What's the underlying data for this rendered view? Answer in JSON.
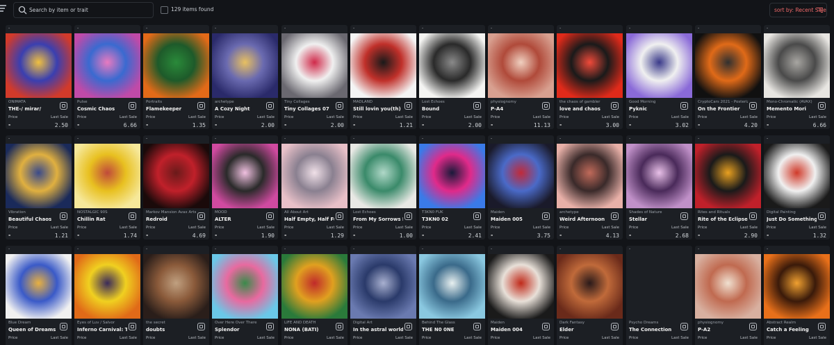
{
  "toolbar": {
    "search_placeholder": "Search by item or trait",
    "items_found": "129 items found",
    "sort_label": "sort by: Recent Sale",
    "accent": "#f06a6a"
  },
  "card_labels": {
    "placeholder": "-",
    "price_label": "Price",
    "last_sale_label": "Last Sale",
    "price_value": "-"
  },
  "items": [
    {
      "collection": "ONIMATA",
      "name": "THE-/ mirar/",
      "last_sale": "2.50",
      "colors": [
        "#d23a2a",
        "#3a3fb0",
        "#f0c040"
      ]
    },
    {
      "collection": "Pulse",
      "name": "Cosmic Chaos",
      "last_sale": "6.66",
      "colors": [
        "#c04aa8",
        "#3a6ad0",
        "#e87ac0"
      ]
    },
    {
      "collection": "Portraits",
      "name": "Flamekeeper",
      "last_sale": "1.35",
      "colors": [
        "#e36a18",
        "#1e5a2a",
        "#2a8a3a"
      ]
    },
    {
      "collection": "archetype",
      "name": "A Cozy Night",
      "last_sale": "2.00",
      "colors": [
        "#2a2a6a",
        "#6a6ab0",
        "#e8c060"
      ]
    },
    {
      "collection": "Tiny Collages",
      "name": "Tiny Collages 07",
      "last_sale": "2.00",
      "colors": [
        "#6a6870",
        "#f0f0f0",
        "#d02a4a"
      ]
    },
    {
      "collection": "MADLAND",
      "name": "Still lovin you(th)",
      "last_sale": "1.21",
      "colors": [
        "#f4f4f4",
        "#c0302a",
        "#1a1a1a"
      ]
    },
    {
      "collection": "Lost Echoes",
      "name": "Bound",
      "last_sale": "2.00",
      "colors": [
        "#f4f4f2",
        "#2a2a2a",
        "#8a8a8a"
      ]
    },
    {
      "collection": "physiognomy",
      "name": "P-A4",
      "last_sale": "11.13",
      "colors": [
        "#d8a090",
        "#b04a3a",
        "#f0d0c0"
      ]
    },
    {
      "collection": "the chaos of gambler",
      "name": "love and chaos",
      "last_sale": "3.00",
      "colors": [
        "#e02a1a",
        "#1a1a1a",
        "#f04a3a"
      ]
    },
    {
      "collection": "Good Morning",
      "name": "Pyknic",
      "last_sale": "3.02",
      "colors": [
        "#8a6ad8",
        "#f0f0f0",
        "#3a3a8a"
      ]
    },
    {
      "collection": "CryptoCars 2021 - Posterized",
      "name": "On the Frontier",
      "last_sale": "4.20",
      "colors": [
        "#101010",
        "#e06a18",
        "#303030"
      ]
    },
    {
      "collection": "Mono-Chromatic (AVAX)",
      "name": "Memento Mori",
      "last_sale": "6.66",
      "colors": [
        "#e8e6e2",
        "#4a4a4a",
        "#a8a6a2"
      ]
    },
    {
      "collection": "Vibration",
      "name": "Beautiful Chaos",
      "last_sale": "1.21",
      "colors": [
        "#1a2a5a",
        "#e0b040",
        "#3a4a8a"
      ]
    },
    {
      "collection": "NOSTALGIC 90S",
      "name": "Chillin Rat",
      "last_sale": "1.74",
      "colors": [
        "#f6e89a",
        "#e8c020",
        "#c04a3a"
      ]
    },
    {
      "collection": "Markov Mansion Avax Arts",
      "name": "Redroid",
      "last_sale": "4.69",
      "colors": [
        "#1a0a0a",
        "#c0202a",
        "#6a1a1a"
      ]
    },
    {
      "collection": "MOOD",
      "name": "ALTER",
      "last_sale": "1.90",
      "colors": [
        "#d04aa0",
        "#2a2a2a",
        "#f0c0e0"
      ]
    },
    {
      "collection": "All About Art",
      "name": "Half Empty, Half Full !",
      "last_sale": "1.29",
      "colors": [
        "#e8c0c8",
        "#8a8090",
        "#f0e0e8"
      ]
    },
    {
      "collection": "Lost Echoes",
      "name": "From My Sorrows I Blo...",
      "last_sale": "1.00",
      "colors": [
        "#e8e8e4",
        "#3a8a6a",
        "#b0d8c8"
      ]
    },
    {
      "collection": "T3KN0 FUK",
      "name": "T3KN0 02",
      "last_sale": "2.41",
      "colors": [
        "#3a7ae8",
        "#e02a8a",
        "#1a1a3a"
      ]
    },
    {
      "collection": "Maiden",
      "name": "Maiden 005",
      "last_sale": "3.75",
      "colors": [
        "#1a1a2a",
        "#4a6ac8",
        "#c02a3a"
      ]
    },
    {
      "collection": "archetype",
      "name": "Weird Afternoon",
      "last_sale": "4.13",
      "colors": [
        "#e8b0a8",
        "#3a2a2a",
        "#c06a5a"
      ]
    },
    {
      "collection": "Shades of Nature",
      "name": "Stellar",
      "last_sale": "2.68",
      "colors": [
        "#c090c8",
        "#4a2a5a",
        "#e8c0e8"
      ]
    },
    {
      "collection": "Rites and Rituals",
      "name": "Rite of the Eclipse",
      "last_sale": "2.90",
      "colors": [
        "#c0202a",
        "#1a1a1a",
        "#e8a020"
      ]
    },
    {
      "collection": "Digital Painting",
      "name": "Just Do Something",
      "last_sale": "1.32",
      "colors": [
        "#1a1a1a",
        "#f0f0f0",
        "#d03a2a"
      ]
    },
    {
      "collection": "Blue Dream",
      "name": "Queen of Dreams",
      "last_sale": "",
      "colors": [
        "#f0f0f0",
        "#3a5ac8",
        "#e8b040"
      ]
    },
    {
      "collection": "Eyes of Luv / Salvor",
      "name": "Inferno Carnival: The B...",
      "last_sale": "",
      "colors": [
        "#e06a18",
        "#f0d020",
        "#3a2a5a"
      ]
    },
    {
      "collection": "the secret",
      "name": "doubts",
      "last_sale": "",
      "colors": [
        "#2a1e1a",
        "#8a5a3a",
        "#c0a080"
      ]
    },
    {
      "collection": "Over Here Over There",
      "name": "Splendor",
      "last_sale": "",
      "colors": [
        "#6ac8e8",
        "#e86aa0",
        "#3a8a4a"
      ]
    },
    {
      "collection": "LIFE AND DEATH",
      "name": "NONA (BATI)",
      "last_sale": "",
      "colors": [
        "#2a7a3a",
        "#e0a020",
        "#c02a2a"
      ]
    },
    {
      "collection": "Digital Art",
      "name": "In the astral world",
      "last_sale": "",
      "colors": [
        "#6a7ab0",
        "#2a3a6a",
        "#a8b0d0"
      ]
    },
    {
      "collection": "Behind The Glass",
      "name": "THE N0 0NE",
      "last_sale": "",
      "colors": [
        "#8ac8e0",
        "#3a6a8a",
        "#e8f0f0"
      ]
    },
    {
      "collection": "Maiden",
      "name": "Maiden 004",
      "last_sale": "",
      "colors": [
        "#1a1a1a",
        "#e8e0d8",
        "#c02a1a"
      ]
    },
    {
      "collection": "Dark Fantasy",
      "name": "Elder",
      "last_sale": "",
      "colors": [
        "#6a2a1a",
        "#c06a3a",
        "#2a1a1a"
      ]
    },
    {
      "collection": "Psycho Dreams",
      "name": "The Connection",
      "last_sale": "",
      "colors": [
        "#1c1f24",
        "#1c1f24",
        "#1c1f24"
      ]
    },
    {
      "collection": "physiognomy",
      "name": "P-A2",
      "last_sale": "",
      "colors": [
        "#d8b0a0",
        "#c06a50",
        "#f0e0d0"
      ]
    },
    {
      "collection": "Abstract Realm",
      "name": "Catch a Feeling",
      "last_sale": "",
      "colors": [
        "#e8701a",
        "#3a1a0a",
        "#f0a030"
      ]
    }
  ]
}
